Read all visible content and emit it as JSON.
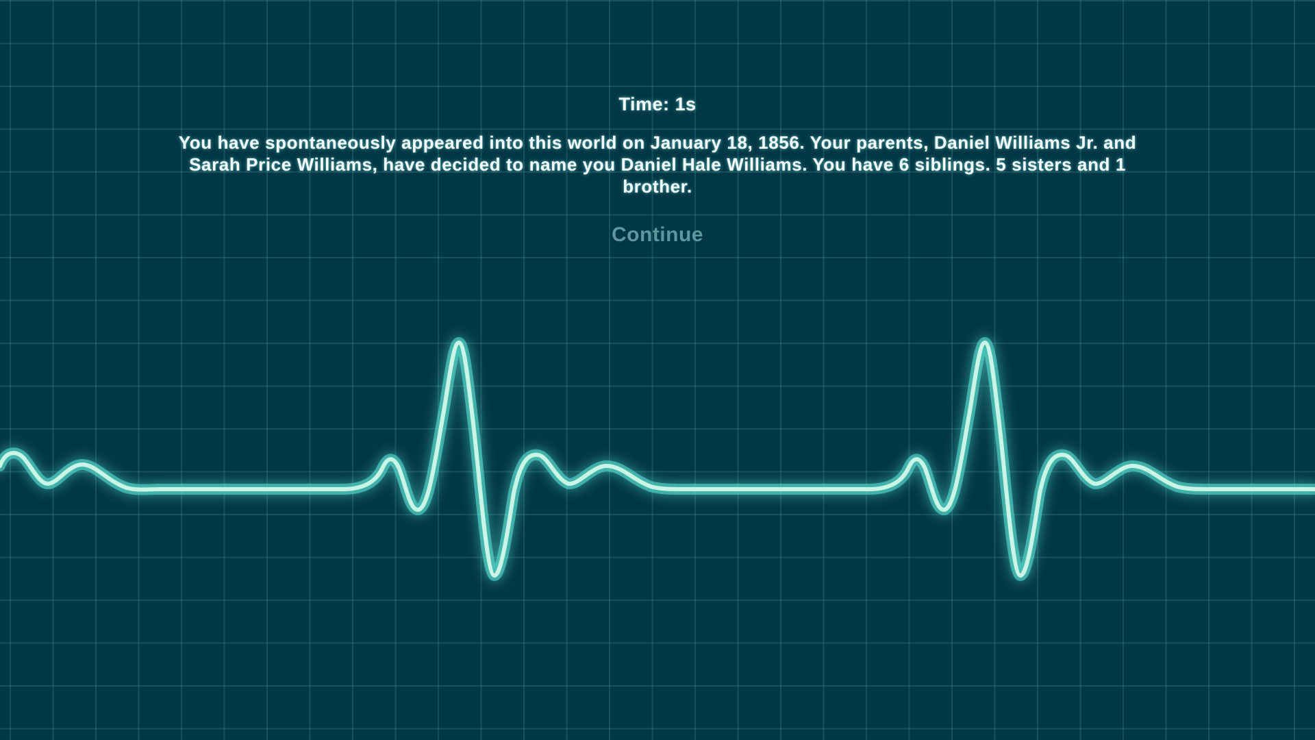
{
  "game": {
    "timer_label": "Time: 1s",
    "story_text": "You have spontaneously appeared into this world on January 18, 1856. Your parents, Daniel Williams Jr. and Sarah Price Williams, have decided to name you Daniel Hale Williams. You have 6 siblings. 5 sisters and 1 brother.",
    "continue_label": "Continue"
  },
  "theme": {
    "background": "#023845",
    "grid_line": "#2f6470",
    "trace_color": "#c8f5e6",
    "trace_glow": "#5fe8d8",
    "text_color": "#f2fbfb",
    "continue_color": "#5f97a0"
  }
}
